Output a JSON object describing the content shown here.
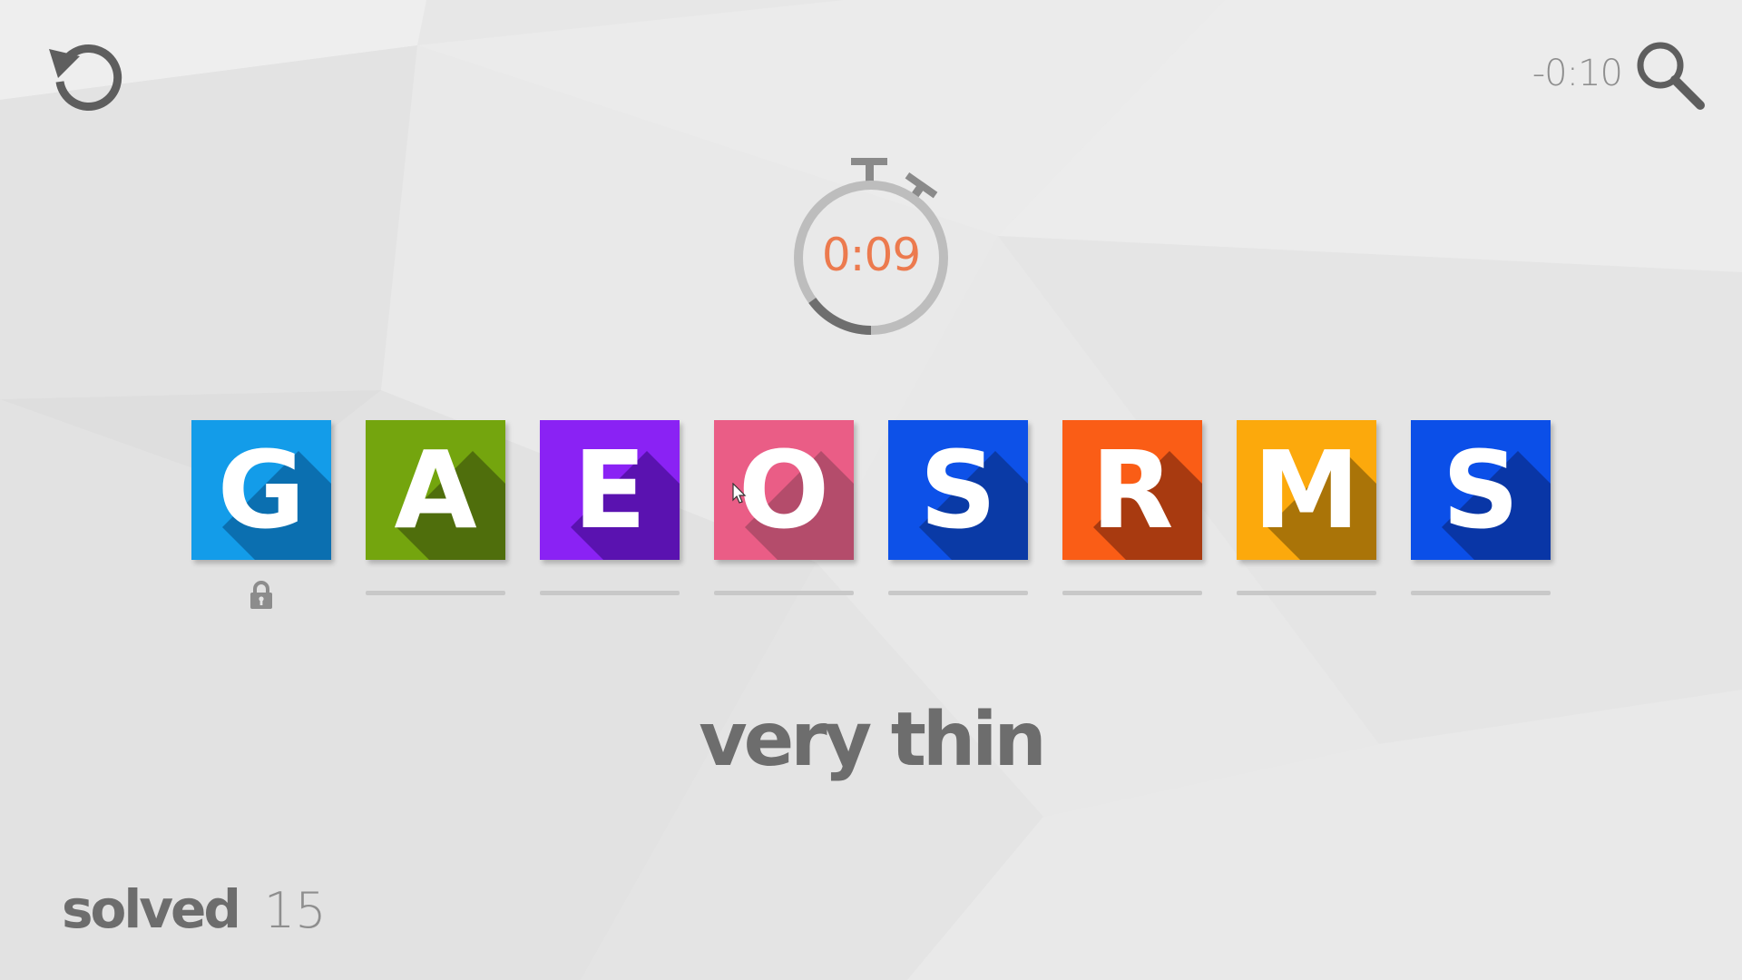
{
  "header": {
    "penalty_time": "-0:10"
  },
  "icons": {
    "undo": "undo-icon",
    "search": "search-icon",
    "lock": "lock-icon"
  },
  "timer": {
    "display": "0:09",
    "progress_fraction": 0.15,
    "color": "#ec7a4e"
  },
  "tiles": [
    {
      "letter": "G",
      "color": "#139ce9",
      "shade": "#0b6fb0",
      "locked": true
    },
    {
      "letter": "A",
      "color": "#74a50e",
      "shade": "#4f6e0c",
      "locked": false
    },
    {
      "letter": "E",
      "color": "#8a22f4",
      "shade": "#5a12b0",
      "locked": false
    },
    {
      "letter": "O",
      "color": "#ea5d86",
      "shade": "#b44c6b",
      "locked": false
    },
    {
      "letter": "S",
      "color": "#0d51e8",
      "shade": "#0a3aa6",
      "locked": false
    },
    {
      "letter": "R",
      "color": "#fa5d16",
      "shade": "#a83a10",
      "locked": false
    },
    {
      "letter": "M",
      "color": "#fca90c",
      "shade": "#aa7408",
      "locked": false
    },
    {
      "letter": "S",
      "color": "#0b4fe8",
      "shade": "#0936a6",
      "locked": false
    }
  ],
  "clue": {
    "text": "very thin"
  },
  "stats": {
    "solved_label": "solved",
    "solved_count": "15"
  }
}
